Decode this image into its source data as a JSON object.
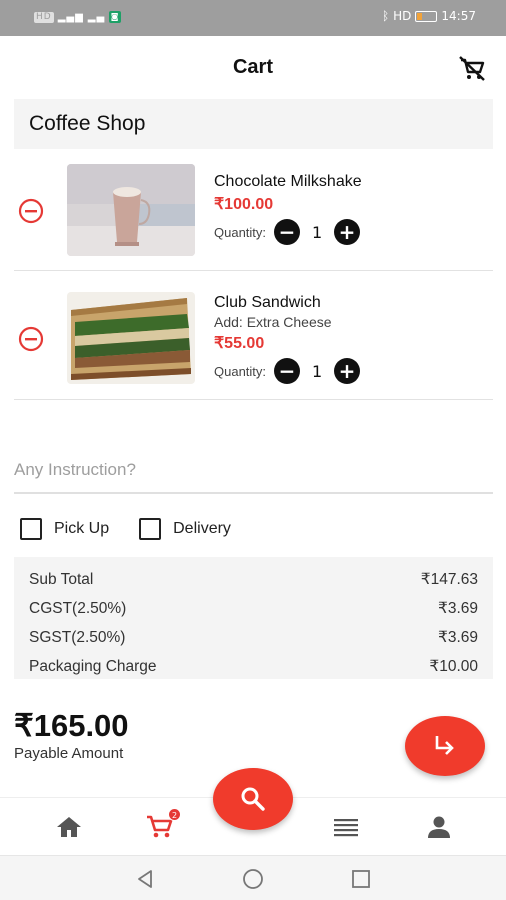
{
  "status_bar": {
    "left_label": "HD",
    "right_label": "HD",
    "time": "14:57"
  },
  "header": {
    "title": "Cart"
  },
  "shop": {
    "name": "Coffee Shop"
  },
  "items": [
    {
      "name": "Chocolate Milkshake",
      "addon": "",
      "price": "₹100.00",
      "quantity_label": "Quantity:",
      "quantity": "1",
      "icon": "milkshake-image"
    },
    {
      "name": "Club Sandwich",
      "addon": "Add: Extra Cheese",
      "price": "₹55.00",
      "quantity_label": "Quantity:",
      "quantity": "1",
      "icon": "sandwich-image"
    }
  ],
  "instruction": {
    "placeholder": "Any Instruction?"
  },
  "options": {
    "pickup_label": "Pick Up",
    "delivery_label": "Delivery"
  },
  "summary": {
    "rows": [
      {
        "label": "Sub Total",
        "value": "₹147.63"
      },
      {
        "label": "CGST(2.50%)",
        "value": "₹3.69"
      },
      {
        "label": "SGST(2.50%)",
        "value": "₹3.69"
      },
      {
        "label": "Packaging Charge",
        "value": "₹10.00"
      }
    ]
  },
  "payable": {
    "amount": "₹165.00",
    "label": "Payable Amount"
  },
  "bottom_nav": {
    "cart_badge": "2"
  },
  "colors": {
    "accent": "#f03b2c",
    "price": "#e53935",
    "panel": "#f4f4f4"
  }
}
